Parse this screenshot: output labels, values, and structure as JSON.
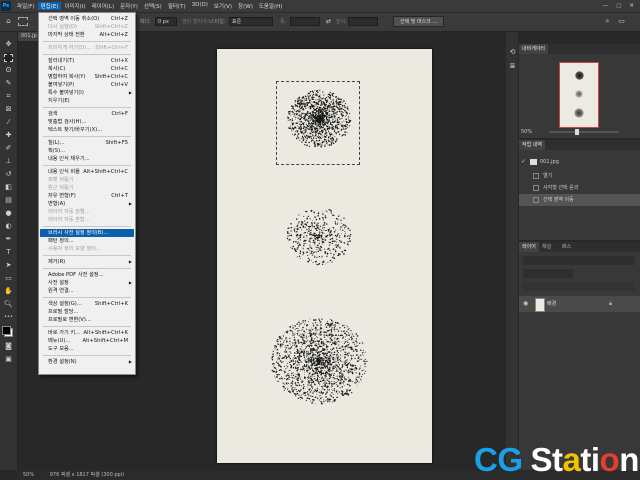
{
  "menubar": {
    "logo": "Ps",
    "items": [
      {
        "label": "파일(F)",
        "active": false
      },
      {
        "label": "편집(E)",
        "active": true
      },
      {
        "label": "이미지(I)",
        "active": false
      },
      {
        "label": "레이어(L)",
        "active": false
      },
      {
        "label": "문자(Y)",
        "active": false
      },
      {
        "label": "선택(S)",
        "active": false
      },
      {
        "label": "필터(T)",
        "active": false
      },
      {
        "label": "3D(D)",
        "active": false
      },
      {
        "label": "보기(V)",
        "active": false
      },
      {
        "label": "창(W)",
        "active": false
      },
      {
        "label": "도움말(H)",
        "active": false
      }
    ],
    "window_buttons": [
      "—",
      "▢",
      "✕"
    ]
  },
  "options_bar": {
    "feather_label": "페더:",
    "feather_value": "0 px",
    "antialias_label": "앤티 앨리어스",
    "style_label": "스타일:",
    "style_value": "표준",
    "width_label": "폭:",
    "height_label": "높이:",
    "select_mask_button": "선택 및 마스크 ..."
  },
  "document_tab": "001.jp",
  "edit_menu": [
    {
      "label": "선택 영역 이동 취소(O)",
      "shortcut": "Ctrl+Z"
    },
    {
      "label": "다시 실행(O)",
      "shortcut": "Shift+Ctrl+Z",
      "disabled": true
    },
    {
      "label": "마지막 상태 전환",
      "shortcut": "Alt+Ctrl+Z"
    },
    {
      "sep": true
    },
    {
      "label": "희미하게 하기(D)...",
      "shortcut": "Shift+Ctrl+F",
      "disabled": true
    },
    {
      "sep": true
    },
    {
      "label": "잘라내기(T)",
      "shortcut": "Ctrl+X"
    },
    {
      "label": "복사(C)",
      "shortcut": "Ctrl+C"
    },
    {
      "label": "병합하여 복사(Y)",
      "shortcut": "Shift+Ctrl+C"
    },
    {
      "label": "붙여넣기(P)",
      "shortcut": "Ctrl+V"
    },
    {
      "label": "특수 붙여넣기(I)",
      "submenu": true
    },
    {
      "label": "지우기(E)"
    },
    {
      "sep": true
    },
    {
      "label": "검색",
      "shortcut": "Ctrl+F"
    },
    {
      "label": "맞춤법 검사(H)..."
    },
    {
      "label": "텍스트 찾기/바꾸기(X)..."
    },
    {
      "sep": true
    },
    {
      "label": "칠(L)...",
      "shortcut": "Shift+F5"
    },
    {
      "label": "획(S)..."
    },
    {
      "label": "내용 인식 채우기..."
    },
    {
      "sep": true
    },
    {
      "label": "내용 인식 비율",
      "shortcut": "Alt+Shift+Ctrl+C"
    },
    {
      "label": "퍼펫 뒤틀기",
      "disabled": true
    },
    {
      "label": "원근 뒤틀기",
      "disabled": true
    },
    {
      "label": "자유 변형(F)",
      "shortcut": "Ctrl+T"
    },
    {
      "label": "변형(A)",
      "submenu": true
    },
    {
      "label": "레이어 자동 정렬...",
      "disabled": true
    },
    {
      "label": "레이어 자동 혼합...",
      "disabled": true
    },
    {
      "sep": true
    },
    {
      "label": "브러시 사전 설정 정의(B)...",
      "highlighted": true
    },
    {
      "label": "패턴 정의..."
    },
    {
      "label": "사용자 정의 모양 정의...",
      "disabled": true
    },
    {
      "sep": true
    },
    {
      "label": "제거(R)",
      "submenu": true
    },
    {
      "sep": true
    },
    {
      "label": "Adobe PDF 사전 설정..."
    },
    {
      "label": "사전 설정",
      "submenu": true
    },
    {
      "label": "원격 연결..."
    },
    {
      "sep": true
    },
    {
      "label": "색상 설정(G)...",
      "shortcut": "Shift+Ctrl+K"
    },
    {
      "label": "프로필 할당..."
    },
    {
      "label": "프로필로 변환(V)..."
    },
    {
      "sep": true
    },
    {
      "label": "바로 가기 키...",
      "shortcut": "Alt+Shift+Ctrl+K"
    },
    {
      "label": "메뉴(U)...",
      "shortcut": "Alt+Shift+Ctrl+M"
    },
    {
      "label": "도구 모음..."
    },
    {
      "sep": true
    },
    {
      "label": "환경 설정(N)",
      "submenu": true
    }
  ],
  "navigator": {
    "tab": "내비게이터",
    "zoom": "50%"
  },
  "history": {
    "tab": "작업 내역",
    "snapshot": "001.jpg",
    "items": [
      {
        "label": "열기",
        "selected": false
      },
      {
        "label": "사각형 선택 윤곽",
        "selected": false
      },
      {
        "label": "선택 영역 이동",
        "selected": true
      }
    ]
  },
  "layers": {
    "tabs": [
      "레이어",
      "채널",
      "패스"
    ],
    "layer_name": "배경"
  },
  "status": {
    "zoom": "50%",
    "doc_info": "976 픽셀 x 1817 픽셀 (300 ppi)"
  },
  "watermark": {
    "cg": "CG",
    "station_a": "St",
    "station_o1": "a",
    "station_b": "ti",
    "station_o2": "o",
    "station_c": "n"
  },
  "colors": {
    "menu_highlight": "#0b5fab",
    "canvas_paper": "#eceae0",
    "watermark_blue": "#1aa0e8"
  }
}
